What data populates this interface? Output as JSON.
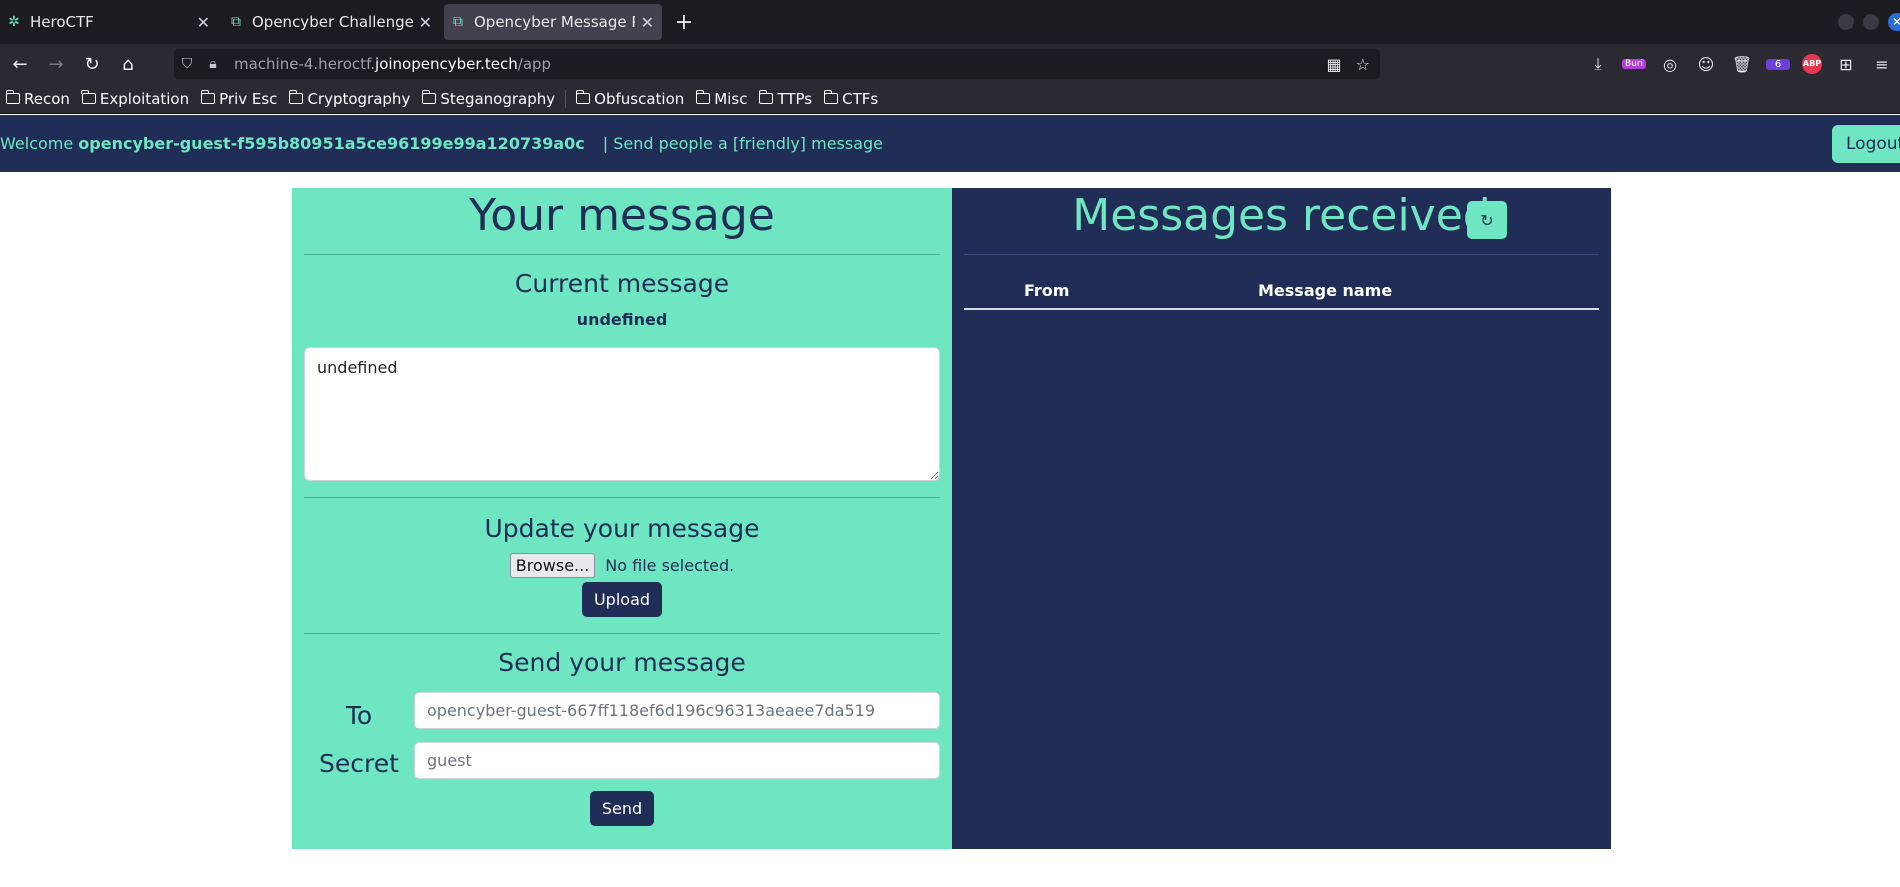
{
  "browser": {
    "tabs": [
      {
        "title": "HeroCTF",
        "icon": "hero-icon",
        "active": false
      },
      {
        "title": "Opencyber Challenge Stat",
        "icon": "opencyber-icon",
        "active": false
      },
      {
        "title": "Opencyber Message Place",
        "icon": "opencyber-icon",
        "active": true
      }
    ],
    "new_tab": "+",
    "url_dim_prefix": "machine-4.heroctf.",
    "url_domain": "joinopencyber.tech",
    "url_dim_suffix": "/app",
    "ext_buri_label": "Buri",
    "ext_six_label": "6",
    "ext_abp_label": "ABP",
    "bookmarks": [
      "Recon",
      "Exploitation",
      "Priv Esc",
      "Cryptography",
      "Steganography",
      "Obfuscation",
      "Misc",
      "TTPs",
      "CTFs"
    ]
  },
  "header": {
    "welcome_prefix": "Welcome",
    "username": "opencyber-guest-f595b80951a5ce96199e99a120739a0c",
    "tagline": "| Send people a [friendly] message",
    "logout_label": "Logout"
  },
  "left": {
    "title": "Your message",
    "current_heading": "Current message",
    "current_name": "undefined",
    "current_body": "undefined",
    "update_heading": "Update your message",
    "browse_label": "Browse...",
    "no_file_text": "No file selected.",
    "upload_label": "Upload",
    "send_heading": "Send your message",
    "to_label": "To",
    "to_placeholder": "opencyber-guest-667ff118ef6d196c96313aeaee7da519",
    "secret_label": "Secret",
    "secret_placeholder": "guest",
    "send_label": "Send"
  },
  "right": {
    "title": "Messages received",
    "refresh_label": "↻",
    "columns": [
      "From",
      "Message name"
    ]
  },
  "colors": {
    "accent": "#6ee6c2",
    "navy": "#1f2d57"
  }
}
